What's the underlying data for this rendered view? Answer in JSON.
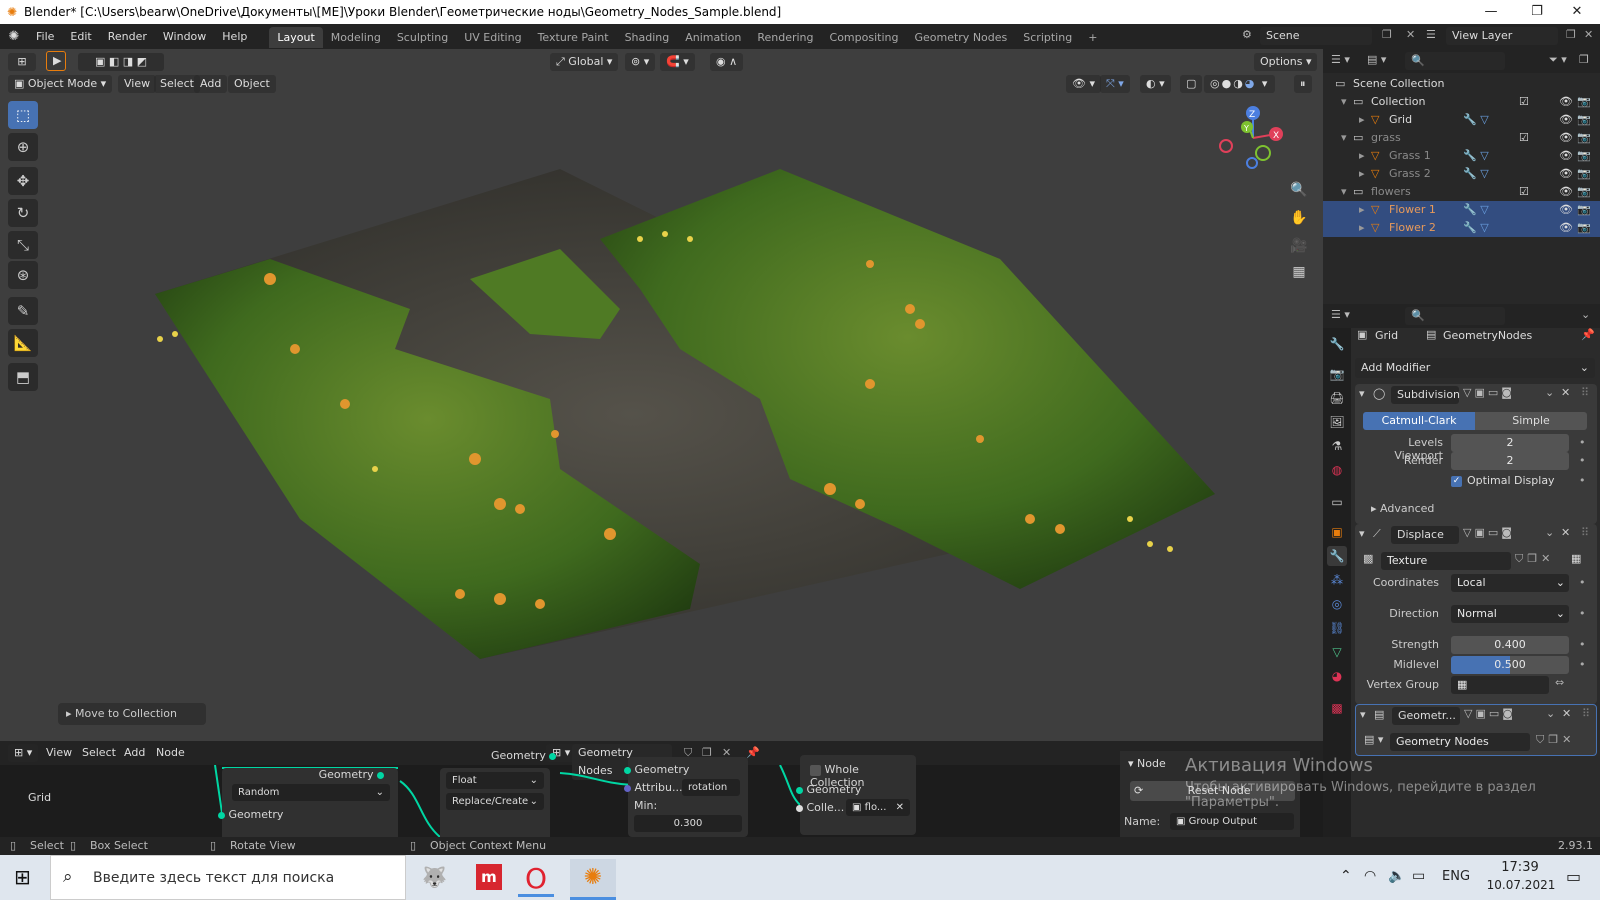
{
  "titlebar": {
    "title": "Blender* [C:\\Users\\bearw\\OneDrive\\Документы\\[ME]\\Уроки Blender\\Геометрические ноды\\Geometry_Nodes_Sample.blend]",
    "minimize": "—",
    "maximize": "❐",
    "close": "✕"
  },
  "topbar": {
    "menus": [
      "File",
      "Edit",
      "Render",
      "Window",
      "Help"
    ],
    "workspaces": [
      "Layout",
      "Modeling",
      "Sculpting",
      "UV Editing",
      "Texture Paint",
      "Shading",
      "Animation",
      "Rendering",
      "Compositing",
      "Geometry Nodes",
      "Scripting"
    ],
    "active_workspace": "Layout",
    "add_tab": "+",
    "scene": "Scene",
    "view_layer": "View Layer"
  },
  "viewport": {
    "mode": "Object Mode",
    "menus": [
      "View",
      "Select",
      "Add",
      "Object"
    ],
    "transform_orientation": "Global",
    "options": "Options",
    "move_to_collection": "Move to Collection",
    "gizmo": {
      "x": "X",
      "y": "Y",
      "z": "Z"
    }
  },
  "outliner": {
    "rows": [
      {
        "label": "Scene Collection",
        "indent": 0,
        "kind": "scene"
      },
      {
        "label": "Collection",
        "indent": 1,
        "kind": "collection"
      },
      {
        "label": "Grid",
        "indent": 2,
        "kind": "object"
      },
      {
        "label": "grass",
        "indent": 1,
        "kind": "collection",
        "dim": true
      },
      {
        "label": "Grass 1",
        "indent": 2,
        "kind": "object",
        "dim": true
      },
      {
        "label": "Grass 2",
        "indent": 2,
        "kind": "object",
        "dim": true
      },
      {
        "label": "flowers",
        "indent": 1,
        "kind": "collection",
        "dim": true
      },
      {
        "label": "Flower 1",
        "indent": 2,
        "kind": "object",
        "selected": true
      },
      {
        "label": "Flower 2",
        "indent": 2,
        "kind": "object",
        "selected": true
      }
    ]
  },
  "properties": {
    "object_name": "Grid",
    "modifier_name_tab": "GeometryNodes",
    "add_modifier": "Add Modifier",
    "subdivision": {
      "name": "Subdivision",
      "type_a": "Catmull-Clark",
      "type_b": "Simple",
      "levels_viewport_label": "Levels Viewport",
      "levels_viewport": "2",
      "render_label": "Render",
      "render": "2",
      "optimal_display": "Optimal Display",
      "advanced": "Advanced"
    },
    "displace": {
      "name": "Displace",
      "texture": "Texture",
      "coordinates_label": "Coordinates",
      "coordinates": "Local",
      "direction_label": "Direction",
      "direction": "Normal",
      "strength_label": "Strength",
      "strength": "0.400",
      "midlevel_label": "Midlevel",
      "midlevel": "0.500",
      "midlevel_fraction": 0.5,
      "vertex_group_label": "Vertex Group"
    },
    "geometry_modifier": {
      "name": "Geometr...",
      "node_group": "Geometry Nodes"
    }
  },
  "node_editor": {
    "menus": [
      "View",
      "Select",
      "Add",
      "Node"
    ],
    "node_tree": "Geometry Nodes",
    "left_node": {
      "label": "Grid",
      "out": "Geometry",
      "dropdown": "Random",
      "in": "Geometry"
    },
    "attr_node": {
      "float": "Float",
      "mode": "Replace/Create"
    },
    "rotate_node": {
      "in_label": "Geometry",
      "out": "Geometry",
      "attribute_label": "Attribu...",
      "attribute": "rotation",
      "min_label": "Min:",
      "min_value": "0.300"
    },
    "collection_node": {
      "whole_collection": "Whole Collection",
      "geometry": "Geometry",
      "collection_label": "Colle...",
      "collection": "flo..."
    },
    "sidebar": {
      "section": "Node",
      "reset": "Reset Node",
      "name_label": "Name:",
      "name": "Group Output"
    }
  },
  "watermark": {
    "line1": "Активация Windows",
    "line2": "Чтобы активировать Windows, перейдите в раздел",
    "line3": "\"Параметры\"."
  },
  "statusbar": {
    "select": "Select",
    "box_select": "Box Select",
    "rotate_view": "Rotate View",
    "context_menu": "Object Context Menu",
    "version": "2.93.1"
  },
  "taskbar": {
    "search_placeholder": "Введите здесь текст для поиска",
    "lang": "ENG",
    "time": "17:39",
    "date": "10.07.2021"
  },
  "colors": {
    "accent": "#4772b3",
    "selection": "#334d80",
    "viewport_bg": "#3e3e3e",
    "orange": "#e87d0d"
  }
}
